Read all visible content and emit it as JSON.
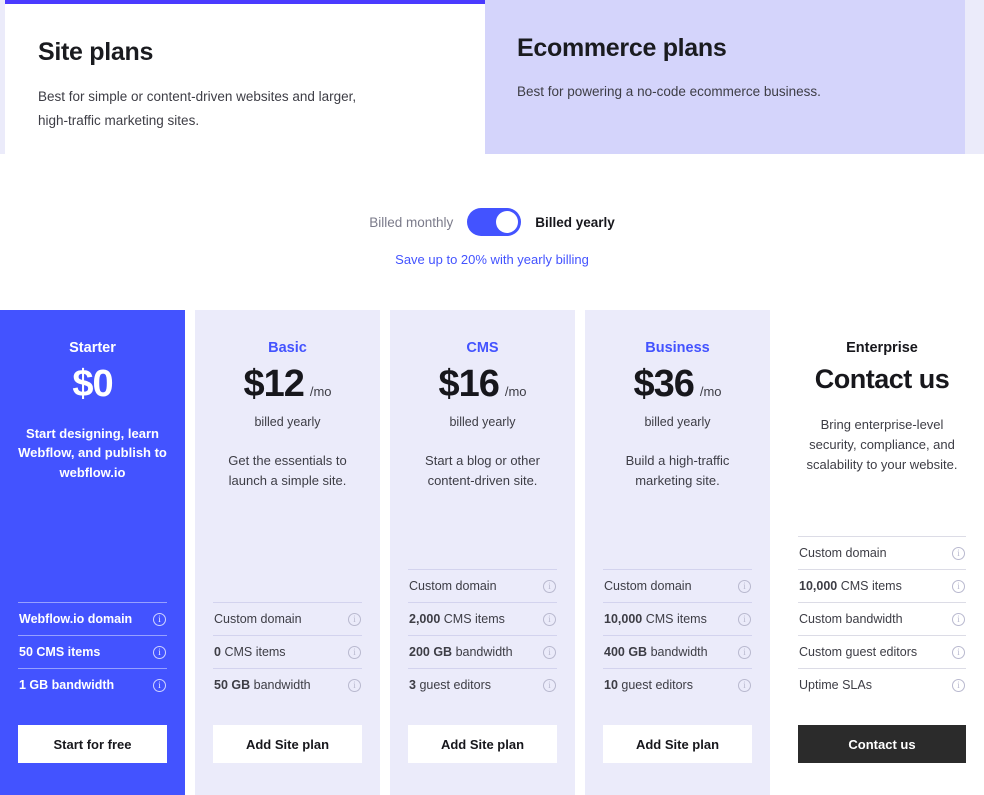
{
  "tabs": [
    {
      "title": "Site plans",
      "description": "Best for simple or content-driven websites and larger, high-traffic marketing sites.",
      "active": true
    },
    {
      "title": "Ecommerce plans",
      "description": "Best for powering a no-code ecommerce business.",
      "active": false
    }
  ],
  "billing": {
    "monthly_label": "Billed monthly",
    "yearly_label": "Billed yearly",
    "toggle_state": "yearly",
    "savings_note": "Save up to 20% with yearly billing",
    "accent_color": "#4353ff"
  },
  "plans": [
    {
      "name": "Starter",
      "price": "$0",
      "price_unit": "",
      "billed_note": "",
      "description": "Start designing, learn Webflow, and publish to webflow.io",
      "features": [
        {
          "num": "",
          "text": "Webflow.io domain"
        },
        {
          "num": "50",
          "text": "CMS items"
        },
        {
          "num": "1 GB",
          "text": "bandwidth"
        }
      ],
      "cta": "Start for free",
      "highlight": true
    },
    {
      "name": "Basic",
      "price": "$12",
      "price_unit": "/mo",
      "billed_note": "billed yearly",
      "description": "Get the essentials to launch a simple site.",
      "features": [
        {
          "num": "",
          "text": "Custom domain"
        },
        {
          "num": "0",
          "text": "CMS items"
        },
        {
          "num": "50 GB",
          "text": "bandwidth"
        }
      ],
      "cta": "Add Site plan",
      "highlight": false
    },
    {
      "name": "CMS",
      "price": "$16",
      "price_unit": "/mo",
      "billed_note": "billed yearly",
      "description": "Start a blog or other content-driven site.",
      "features": [
        {
          "num": "",
          "text": "Custom domain"
        },
        {
          "num": "2,000",
          "text": "CMS items"
        },
        {
          "num": "200 GB",
          "text": "bandwidth"
        },
        {
          "num": "3",
          "text": "guest editors"
        }
      ],
      "cta": "Add Site plan",
      "highlight": false
    },
    {
      "name": "Business",
      "price": "$36",
      "price_unit": "/mo",
      "billed_note": "billed yearly",
      "description": "Build a high-traffic marketing site.",
      "features": [
        {
          "num": "",
          "text": "Custom domain"
        },
        {
          "num": "10,000",
          "text": "CMS items"
        },
        {
          "num": "400 GB",
          "text": "bandwidth"
        },
        {
          "num": "10",
          "text": "guest editors"
        }
      ],
      "cta": "Add Site plan",
      "highlight": false
    },
    {
      "name": "Enterprise",
      "price": "Contact us",
      "price_unit": "",
      "billed_note": "",
      "description": "Bring enterprise-level security, compliance, and scalability to your website.",
      "features": [
        {
          "num": "",
          "text": "Custom domain"
        },
        {
          "num": "10,000",
          "text": "CMS items"
        },
        {
          "num": "",
          "text": "Custom bandwidth"
        },
        {
          "num": "",
          "text": "Custom guest editors"
        },
        {
          "num": "",
          "text": "Uptime SLAs"
        }
      ],
      "cta": "Contact us",
      "highlight": false
    }
  ],
  "icons": {
    "info": "info-icon"
  }
}
